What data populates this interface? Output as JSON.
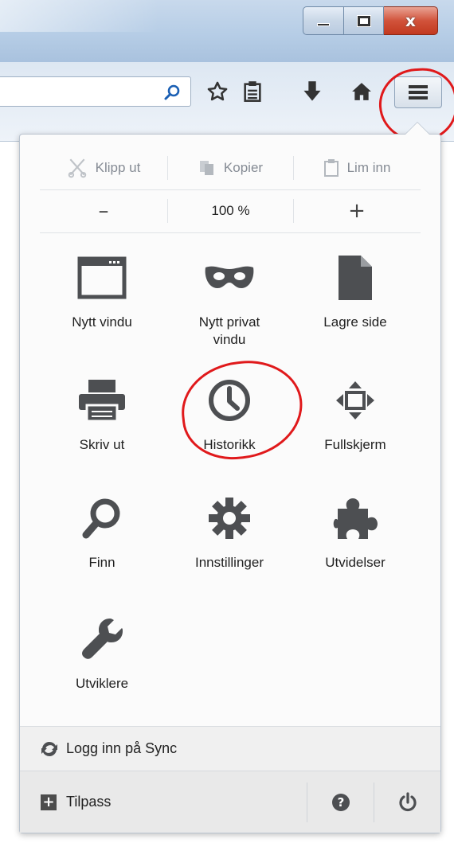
{
  "window": {
    "minimize_icon": "minimize-icon",
    "maximize_icon": "maximize-icon",
    "close_glyph": "x"
  },
  "toolbar": {
    "icons": [
      "search-icon",
      "star-icon",
      "reading-list-icon",
      "download-arrow-icon",
      "home-icon",
      "hamburger-menu-icon"
    ]
  },
  "menu": {
    "edit": {
      "cut": "Klipp ut",
      "copy": "Kopier",
      "paste": "Lim inn"
    },
    "zoom": {
      "minus": "–",
      "level": "100 %",
      "plus": "+"
    },
    "items": [
      {
        "label": "Nytt vindu",
        "icon": "window-icon"
      },
      {
        "label": "Nytt privat vindu",
        "icon": "mask-icon"
      },
      {
        "label": "Lagre side",
        "icon": "page-icon"
      },
      {
        "label": "Skriv ut",
        "icon": "printer-icon"
      },
      {
        "label": "Historikk",
        "icon": "clock-icon"
      },
      {
        "label": "Fullskjerm",
        "icon": "fullscreen-icon"
      },
      {
        "label": "Finn",
        "icon": "magnifier-icon"
      },
      {
        "label": "Innstillinger",
        "icon": "gear-icon"
      },
      {
        "label": "Utvidelser",
        "icon": "puzzle-icon"
      },
      {
        "label": "Utviklere",
        "icon": "wrench-icon"
      }
    ],
    "sync_label": "Logg inn på Sync",
    "customize_label": "Tilpass",
    "help_icon": "help-icon",
    "quit_icon": "power-icon"
  },
  "colors": {
    "annotation": "#e0191b",
    "icon_gray": "#4d4f52"
  }
}
